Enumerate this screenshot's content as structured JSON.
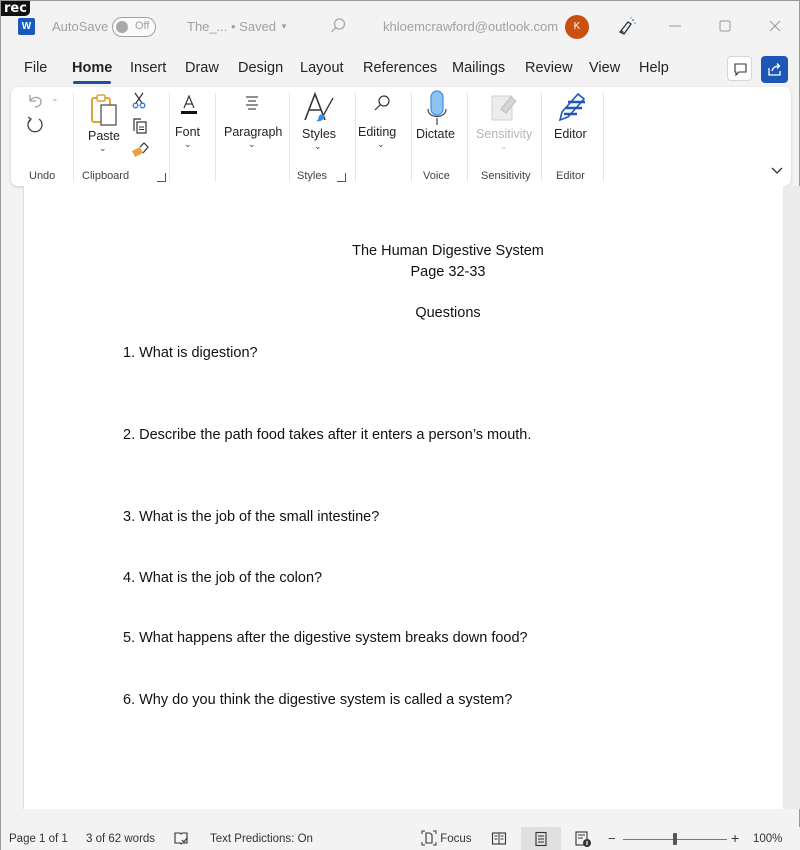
{
  "overlay": {
    "rec_label": "rec"
  },
  "titlebar": {
    "app_icon": "word-logo-icon",
    "app_letter": "W",
    "autosave_label": "AutoSave",
    "autosave_state": "Off",
    "document_title": "The_...",
    "save_status": "• Saved",
    "account_email": "khloemcrawford@outlook.com",
    "avatar_initial": "K",
    "colors": {
      "avatar": "#ca5010",
      "word_brand": "#185abd"
    }
  },
  "menu": {
    "tabs": [
      {
        "label": "File",
        "active": false
      },
      {
        "label": "Home",
        "active": true
      },
      {
        "label": "Insert",
        "active": false
      },
      {
        "label": "Draw",
        "active": false
      },
      {
        "label": "Design",
        "active": false
      },
      {
        "label": "Layout",
        "active": false
      },
      {
        "label": "References",
        "active": false
      },
      {
        "label": "Mailings",
        "active": false
      },
      {
        "label": "Review",
        "active": false
      },
      {
        "label": "View",
        "active": false
      },
      {
        "label": "Help",
        "active": false
      }
    ],
    "accent_color": "#1e4fa3",
    "share_color": "#1e56b8"
  },
  "ribbon": {
    "groups": {
      "undo": {
        "label": "Undo"
      },
      "clipboard": {
        "label": "Clipboard",
        "paste_label": "Paste"
      },
      "font": {
        "label": "Font"
      },
      "paragraph": {
        "label": "Paragraph"
      },
      "styles": {
        "label": "Styles",
        "button_label": "Styles"
      },
      "editing": {
        "label": "Editing"
      },
      "voice": {
        "label": "Voice",
        "button_label": "Dictate"
      },
      "sensitivity": {
        "label": "Sensitivity",
        "button_label": "Sensitivity",
        "disabled": true
      },
      "editor": {
        "label": "Editor",
        "button_label": "Editor"
      }
    }
  },
  "document": {
    "title": "The Human Digestive System",
    "subtitle": "Page 32-33",
    "section_heading": "Questions",
    "questions": [
      "1. What is digestion?",
      "2. Describe the path food takes after it enters a person’s mouth.",
      "3. What is the job of the small intestine?",
      "4.  What is the job of the colon?",
      "5. What happens after the digestive system breaks down food?",
      "6. Why do you think the digestive system is called a system?"
    ]
  },
  "statusbar": {
    "page_info": "Page 1 of 1",
    "word_count": "3 of 62 words",
    "text_predictions": "Text Predictions: On",
    "focus_label": "Focus",
    "zoom_minus": "−",
    "zoom_plus": "+",
    "zoom_level": "100%",
    "zoom_percent": 100,
    "active_view": "print-layout"
  }
}
